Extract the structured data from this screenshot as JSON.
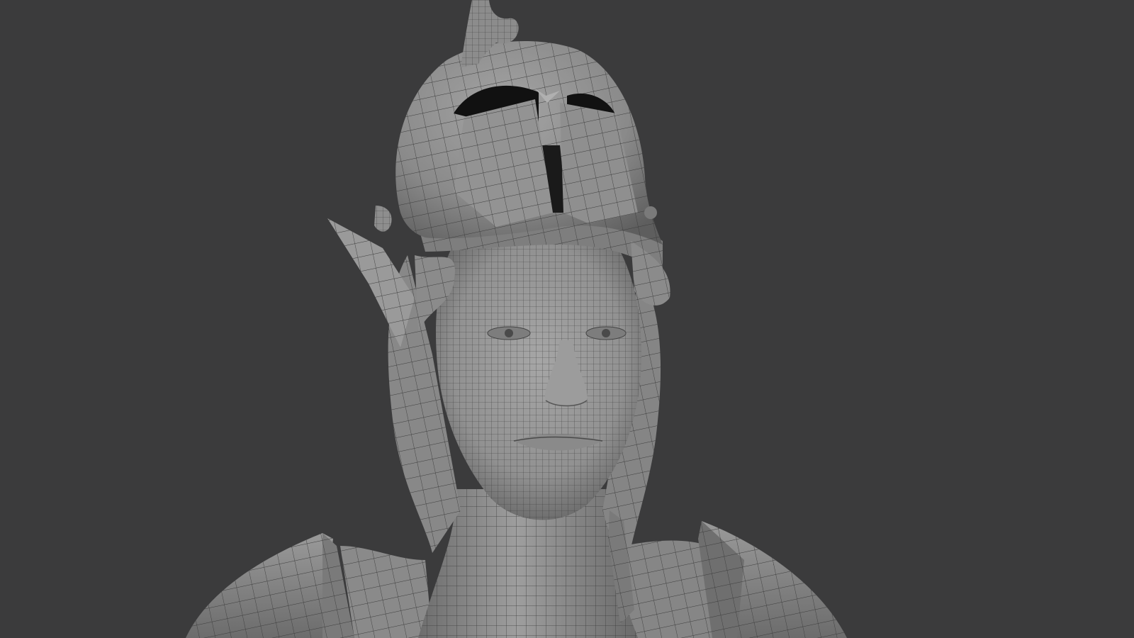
{
  "scene": {
    "background_color": "#3b3b3c",
    "mesh_color": "#8d8d8d",
    "wire_color": "#3a3a3a",
    "shade_dark": "#5a5a5a",
    "shade_light": "#a8a8a8",
    "cavity_color": "#111111"
  }
}
